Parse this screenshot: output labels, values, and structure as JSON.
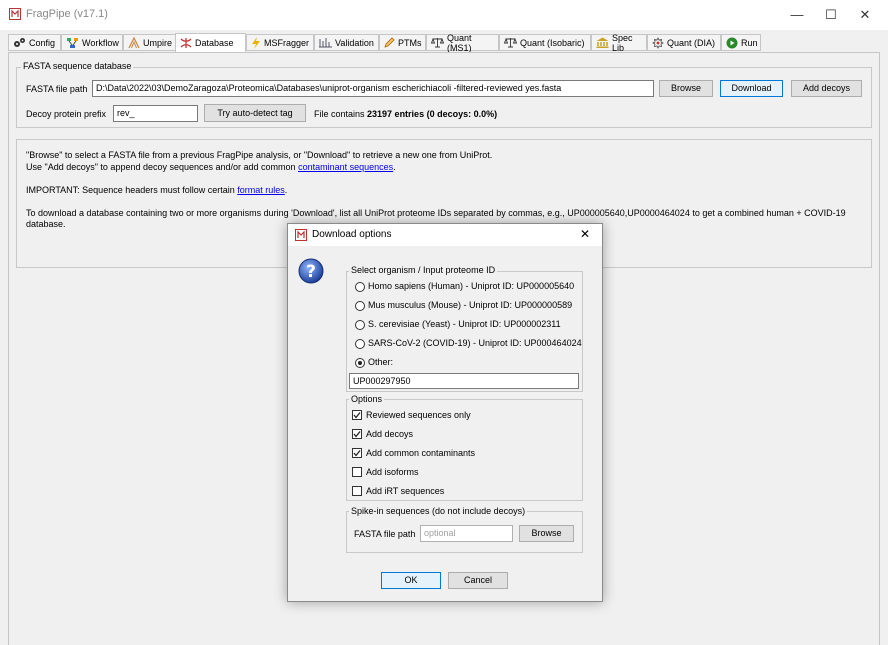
{
  "window": {
    "title": "FragPipe (v17.1)",
    "minimize": "—",
    "maximize": "☐",
    "close": "✕"
  },
  "tabs": [
    {
      "label": "Config",
      "icon": "gears-icon"
    },
    {
      "label": "Workflow",
      "icon": "workflow-icon"
    },
    {
      "label": "Umpire",
      "icon": "umpire-icon"
    },
    {
      "label": "Database",
      "icon": "database-icon"
    },
    {
      "label": "MSFragger",
      "icon": "msfragger-icon"
    },
    {
      "label": "Validation",
      "icon": "validation-icon"
    },
    {
      "label": "PTMs",
      "icon": "pencil-icon"
    },
    {
      "label": "Quant (MS1)",
      "icon": "scale-icon"
    },
    {
      "label": "Quant (Isobaric)",
      "icon": "scale-icon"
    },
    {
      "label": "Spec Lib",
      "icon": "library-icon"
    },
    {
      "label": "Quant (DIA)",
      "icon": "dia-icon"
    },
    {
      "label": "Run",
      "icon": "play-icon"
    }
  ],
  "fasta": {
    "group_title": "FASTA sequence database",
    "path_label": "FASTA file path",
    "path_value": "D:\\Data\\2022\\03\\DemoZaragoza\\Proteomica\\Databases\\uniprot-organism escherichiacoli -filtered-reviewed yes.fasta",
    "browse": "Browse",
    "download": "Download",
    "add_decoys": "Add decoys",
    "decoy_label": "Decoy protein prefix",
    "decoy_value": "rev_",
    "autodetect": "Try auto-detect tag",
    "contains_prefix": "File contains ",
    "contains_bold": "23197 entries (0 decoys: 0.0%)"
  },
  "info": {
    "line1": "\"Browse\" to select a FASTA file from a previous FragPipe analysis, or \"Download\" to retrieve a new one from UniProt.",
    "line2_pre": "Use \"Add decoys\" to append decoy sequences and/or add common ",
    "line2_link": "contaminant sequences",
    "line2_post": ".",
    "line3_pre": "IMPORTANT: Sequence headers must follow certain ",
    "line3_link": "format rules",
    "line3_post": ".",
    "line4": "To download a database containing two or more organisms during 'Download', list all UniProt proteome IDs separated by commas, e.g., UP000005640,UP0000464024 to get a combined human + COVID-19",
    "line5": "database."
  },
  "dialog": {
    "title": "Download options",
    "close": "✕",
    "organism_group": "Select organism / Input proteome ID",
    "organisms": [
      {
        "label": "Homo sapiens (Human) - Uniprot ID: UP000005640",
        "selected": false
      },
      {
        "label": "Mus musculus (Mouse) - Uniprot ID: UP000000589",
        "selected": false
      },
      {
        "label": "S. cerevisiae (Yeast) - Uniprot ID: UP000002311",
        "selected": false
      },
      {
        "label": "SARS-CoV-2 (COVID-19) - Uniprot ID: UP000464024",
        "selected": false
      },
      {
        "label": "Other:",
        "selected": true
      }
    ],
    "other_value": "UP000297950",
    "options_group": "Options",
    "options": [
      {
        "label": "Reviewed sequences only",
        "checked": true
      },
      {
        "label": "Add decoys",
        "checked": true
      },
      {
        "label": "Add common contaminants",
        "checked": true
      },
      {
        "label": "Add isoforms",
        "checked": false
      },
      {
        "label": "Add iRT sequences",
        "checked": false
      }
    ],
    "spikein_group": "Spike-in sequences (do not include decoys)",
    "spikein_label": "FASTA file path",
    "spikein_placeholder": "optional",
    "spikein_browse": "Browse",
    "ok": "OK",
    "cancel": "Cancel"
  }
}
